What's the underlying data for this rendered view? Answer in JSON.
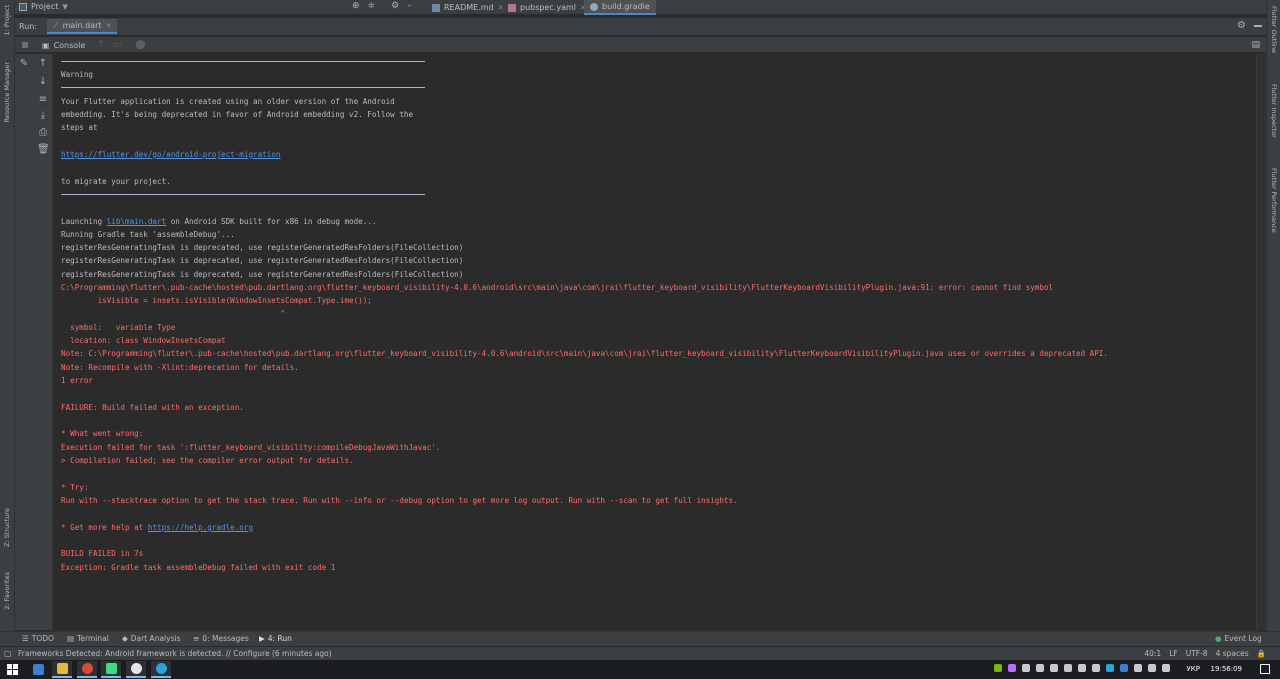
{
  "top_bar": {
    "project_label": "Project",
    "tabs": [
      {
        "label": "README.md"
      },
      {
        "label": "pubspec.yaml"
      },
      {
        "label": "build.gradle"
      }
    ]
  },
  "left_stripe": {
    "items": [
      "1: Project",
      "Resource Manager",
      "Z: Structure",
      "2: Favorites"
    ]
  },
  "right_stripe": {
    "items": [
      "Flutter Outline",
      "Flutter Inspector",
      "Flutter Performance"
    ]
  },
  "run_bar": {
    "run_label": "Run:",
    "run_tab_label": "main.dart"
  },
  "console_header": {
    "console_label": "Console"
  },
  "console": {
    "warning_title": "Warning",
    "warn_lines": [
      "Your Flutter application is created using an older version of the Android",
      "embedding. It's being deprecated in favor of Android embedding v2. Follow the",
      "steps at"
    ],
    "migration_link": "https://flutter.dev/go/android-project-migration",
    "migrate_text": "to migrate your project.",
    "launching_prefix": "Launching ",
    "launching_link": "lib\\main.dart",
    "launching_suffix": " on Android SDK built for x86 in debug mode...",
    "white_lines": [
      "Running Gradle task 'assembleDebug'...",
      "registerResGeneratingTask is deprecated, use registerGeneratedResFolders(FileCollection)",
      "registerResGeneratingTask is deprecated, use registerGeneratedResFolders(FileCollection)",
      "registerResGeneratingTask is deprecated, use registerGeneratedResFolders(FileCollection)"
    ],
    "error_lines": [
      "C:\\Programming\\flutter\\.pub-cache\\hosted\\pub.dartlang.org\\flutter_keyboard_visibility-4.0.6\\android\\src\\main\\java\\com\\jrai\\flutter_keyboard_visibility\\FlutterKeyboardVisibilityPlugin.java:91: error: cannot find symbol",
      "        isVisible = insets.isVisible(WindowInsetsCompat.Type.ime());",
      "                                                ^",
      "  symbol:   variable Type",
      "  location: class WindowInsetsCompat",
      "Note: C:\\Programming\\flutter\\.pub-cache\\hosted\\pub.dartlang.org\\flutter_keyboard_visibility-4.0.6\\android\\src\\main\\java\\com\\jrai\\flutter_keyboard_visibility\\FlutterKeyboardVisibilityPlugin.java uses or overrides a deprecated API.",
      "Note: Recompile with -Xlint:deprecation for details.",
      "1 error"
    ],
    "failure_line": "FAILURE: Build failed with an exception.",
    "what_went_wrong": "* What went wrong:",
    "execution_failed": "Execution failed for task ':flutter_keyboard_visibility:compileDebugJavaWithJavac'.",
    "compilation_failed": "> Compilation failed; see the compiler error output for details.",
    "try_label": "* Try:",
    "try_line": "Run with --stacktrace option to get the stack trace. Run with --info or --debug option to get more log output. Run with --scan to get full insights.",
    "help_prefix": "* Get more help at ",
    "help_link": "https://help.gradle.org",
    "build_failed": "BUILD FAILED in 7s",
    "exception_line": "Exception: Gradle task assembleDebug failed with exit code 1"
  },
  "tool_windows": [
    {
      "label": "TODO"
    },
    {
      "label": "Terminal"
    },
    {
      "label": "Dart Analysis"
    },
    {
      "label": "0: Messages"
    },
    {
      "label": "4: Run"
    }
  ],
  "event_log_label": "Event Log",
  "status_bar": {
    "message": "Frameworks Detected: Android framework is detected. // Configure (6 minutes ago)",
    "position": "40:1",
    "line_separator": "LF",
    "encoding": "UTF-8",
    "indent": "4 spaces"
  },
  "taskbar": {
    "language": "УКР",
    "time": "19:56:09"
  },
  "colors": {
    "error_text": "#ff6b68",
    "link": "#5394ec",
    "accent": "#4a88c7"
  }
}
